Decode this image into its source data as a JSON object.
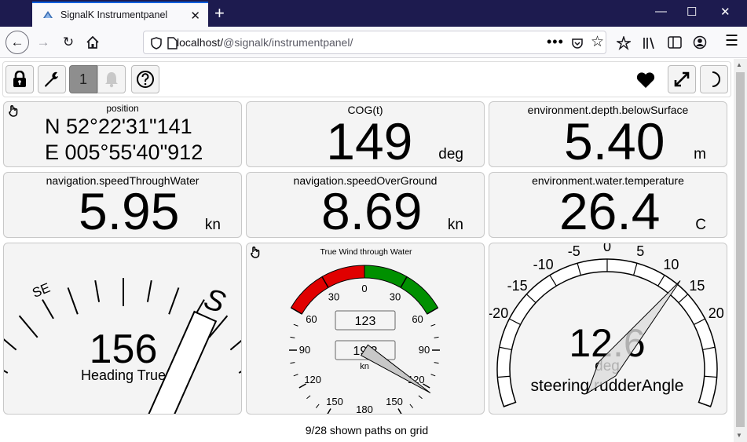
{
  "browser": {
    "tab_title": "SignalK Instrumentpanel",
    "url_host": "localhost/",
    "url_path": "@signalk/instrumentpanel/"
  },
  "toolbar": {
    "notification_count": "1"
  },
  "widgets": {
    "position": {
      "label": "position",
      "lat": "N 52°22'31\"141",
      "lon": "E 005°55'40\"912"
    },
    "cog": {
      "label": "COG(t)",
      "value": "149",
      "unit": "deg"
    },
    "depth": {
      "label": "environment.depth.belowSurface",
      "value": "5.40",
      "unit": "m"
    },
    "stw": {
      "label": "navigation.speedThroughWater",
      "value": "5.95",
      "unit": "kn"
    },
    "sog": {
      "label": "navigation.speedOverGround",
      "value": "8.69",
      "unit": "kn"
    },
    "water_temp": {
      "label": "environment.water.temperature",
      "value": "26.4",
      "unit": "C"
    },
    "heading": {
      "value": "156",
      "label": "Heading True",
      "compass_labels": [
        "SE",
        "S"
      ],
      "heading_deg": 156
    },
    "wind": {
      "title": "True Wind through Water",
      "angle_value": "123",
      "speed_value": "19.2",
      "speed_unit": "kn",
      "scale_labels": [
        "0",
        "30",
        "30",
        "60",
        "60",
        "90",
        "90",
        "120",
        "120",
        "150",
        "150",
        "180"
      ],
      "angle_deg": 123
    },
    "rudder": {
      "value": "12.6",
      "unit": "deg",
      "label": "steering.rudderAngle",
      "scale_labels": [
        "-20",
        "-15",
        "-10",
        "-5",
        "0",
        "5",
        "10",
        "15",
        "20"
      ],
      "angle_deg": 12.6
    }
  },
  "footer": {
    "text": "9/28 shown paths on grid"
  },
  "colors": {
    "titlebar": "#1d1b4f",
    "widget_bg": "#f4f4f4",
    "red_sector": "#e00000",
    "green_sector": "#009000"
  }
}
